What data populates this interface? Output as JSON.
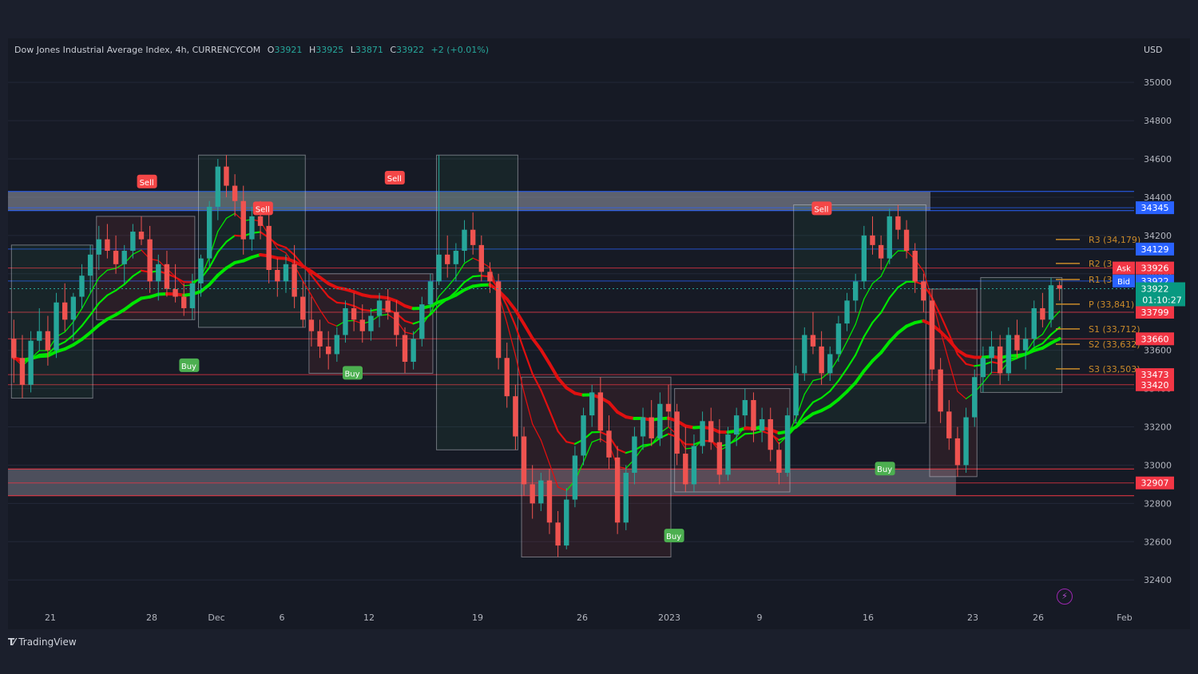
{
  "header": {
    "symbol": "Dow Jones Industrial Average Index, 4h, CURRENCYCOM",
    "o_label": "O",
    "o_value": "33921",
    "h_label": "H",
    "h_value": "33925",
    "l_label": "L",
    "l_value": "33871",
    "c_label": "C",
    "c_value": "33922",
    "change": "+2 (+0.01%)",
    "currency": "USD"
  },
  "branding": {
    "logo": "TradingView"
  },
  "colors": {
    "background": "#161a25",
    "up": "#26a69a",
    "down": "#ef5350",
    "ema_green": "#00e600",
    "ema_red": "#e01010",
    "pivot": "#c98a2a",
    "level_blue": "#2962ff",
    "level_red": "#f23645",
    "buy": "#4caf50",
    "sell": "#f44747"
  },
  "chart_data": {
    "type": "candlestick",
    "timeframe": "4h",
    "price_range": [
      32280,
      35130
    ],
    "x_ticks": [
      "21",
      "28",
      "Dec",
      "6",
      "12",
      "19",
      "26",
      "2023",
      "9",
      "16",
      "23",
      "26",
      "Feb"
    ],
    "y_ticks": [
      35000,
      34800,
      34600,
      34400,
      34200,
      34000,
      33800,
      33600,
      33400,
      33200,
      33000,
      32800,
      32600,
      32400
    ],
    "pivots": [
      {
        "label": "R3 (34,179)",
        "value": 34179
      },
      {
        "label": "R2 (3",
        "value": 34054
      },
      {
        "label": "R1 (3",
        "value": 33970
      },
      {
        "label": "P (33,841)",
        "value": 33841
      },
      {
        "label": "S1 (33,712)",
        "value": 33712
      },
      {
        "label": "S2 (33,632)",
        "value": 33632
      },
      {
        "label": "S3 (33,503)",
        "value": 33503
      }
    ],
    "price_tags": [
      {
        "text": "34345",
        "value": 34345,
        "color": "#2962ff"
      },
      {
        "text": "34129",
        "value": 34129,
        "color": "#2962ff"
      },
      {
        "text": "33926",
        "value": 34030,
        "color": "#f23645",
        "prefix": "Ask"
      },
      {
        "text": "33922",
        "value": 33962,
        "color": "#2962ff",
        "prefix": "Bid"
      },
      {
        "text": "33799",
        "value": 33799,
        "color": "#f23645"
      },
      {
        "text": "33660",
        "value": 33660,
        "color": "#f23645"
      },
      {
        "text": "33473",
        "value": 33473,
        "color": "#f23645"
      },
      {
        "text": "33420",
        "value": 33420,
        "color": "#f23645"
      },
      {
        "text": "32907",
        "value": 32907,
        "color": "#f23645"
      }
    ],
    "last_price": {
      "value": 33922,
      "countdown": "01:10:27"
    },
    "signals": [
      {
        "type": "Sell",
        "x": 0.13,
        "price": 34480
      },
      {
        "type": "Buy",
        "x": 0.17,
        "price": 33520
      },
      {
        "type": "Sell",
        "x": 0.24,
        "price": 34340
      },
      {
        "type": "Buy",
        "x": 0.325,
        "price": 33480
      },
      {
        "type": "Sell",
        "x": 0.365,
        "price": 34500
      },
      {
        "type": "Buy",
        "x": 0.63,
        "price": 32630
      },
      {
        "type": "Sell",
        "x": 0.77,
        "price": 34340
      },
      {
        "type": "Buy",
        "x": 0.83,
        "price": 32980
      }
    ],
    "zones": [
      {
        "from": 34330,
        "to": 34430,
        "color": "blue"
      },
      {
        "from": 32840,
        "to": 32980,
        "color": "red"
      }
    ],
    "candles": [
      [
        33660,
        33760,
        33430,
        33560
      ],
      [
        33560,
        33680,
        33350,
        33420
      ],
      [
        33420,
        33700,
        33380,
        33650
      ],
      [
        33650,
        33820,
        33600,
        33700
      ],
      [
        33700,
        33780,
        33520,
        33600
      ],
      [
        33600,
        33900,
        33560,
        33850
      ],
      [
        33850,
        33950,
        33700,
        33760
      ],
      [
        33760,
        33900,
        33650,
        33880
      ],
      [
        33880,
        34050,
        33820,
        33990
      ],
      [
        33990,
        34150,
        33900,
        34100
      ],
      [
        34100,
        34250,
        34020,
        34180
      ],
      [
        34180,
        34260,
        34080,
        34120
      ],
      [
        34120,
        34200,
        34000,
        34050
      ],
      [
        34050,
        34150,
        33950,
        34120
      ],
      [
        34120,
        34260,
        34080,
        34220
      ],
      [
        34220,
        34300,
        34150,
        34180
      ],
      [
        34180,
        34250,
        33900,
        33960
      ],
      [
        33960,
        34100,
        33860,
        34050
      ],
      [
        34050,
        34120,
        33880,
        33920
      ],
      [
        33920,
        34050,
        33850,
        33880
      ],
      [
        33880,
        33950,
        33780,
        33820
      ],
      [
        33820,
        34000,
        33760,
        33950
      ],
      [
        33950,
        34100,
        33880,
        34080
      ],
      [
        34080,
        34380,
        34040,
        34350
      ],
      [
        34350,
        34600,
        34280,
        34560
      ],
      [
        34560,
        34620,
        34400,
        34460
      ],
      [
        34460,
        34520,
        34300,
        34380
      ],
      [
        34380,
        34460,
        34100,
        34180
      ],
      [
        34180,
        34350,
        34120,
        34300
      ],
      [
        34300,
        34380,
        34180,
        34250
      ],
      [
        34250,
        34320,
        33950,
        34020
      ],
      [
        34020,
        34080,
        33880,
        33960
      ],
      [
        33960,
        34100,
        33900,
        34050
      ],
      [
        34050,
        34150,
        33820,
        33880
      ],
      [
        33880,
        33960,
        33720,
        33760
      ],
      [
        33760,
        33880,
        33620,
        33700
      ],
      [
        33700,
        33760,
        33560,
        33620
      ],
      [
        33620,
        33700,
        33500,
        33580
      ],
      [
        33580,
        33720,
        33540,
        33680
      ],
      [
        33680,
        33860,
        33640,
        33820
      ],
      [
        33820,
        33900,
        33700,
        33760
      ],
      [
        33760,
        33840,
        33640,
        33700
      ],
      [
        33700,
        33820,
        33650,
        33780
      ],
      [
        33780,
        33900,
        33720,
        33860
      ],
      [
        33860,
        33920,
        33760,
        33800
      ],
      [
        33800,
        33860,
        33620,
        33680
      ],
      [
        33680,
        33720,
        33480,
        33540
      ],
      [
        33540,
        33700,
        33500,
        33660
      ],
      [
        33660,
        33880,
        33620,
        33840
      ],
      [
        33840,
        34000,
        33800,
        33960
      ],
      [
        33960,
        34620,
        33940,
        34100
      ],
      [
        34100,
        34200,
        33980,
        34050
      ],
      [
        34050,
        34160,
        33960,
        34120
      ],
      [
        34120,
        34280,
        34060,
        34230
      ],
      [
        34230,
        34320,
        34100,
        34150
      ],
      [
        34150,
        34200,
        33960,
        34010
      ],
      [
        34010,
        34060,
        33900,
        33960
      ],
      [
        33960,
        34000,
        33500,
        33560
      ],
      [
        33560,
        33640,
        33300,
        33360
      ],
      [
        33360,
        33420,
        33080,
        33150
      ],
      [
        33150,
        33200,
        32840,
        32900
      ],
      [
        32900,
        33000,
        32720,
        32800
      ],
      [
        32800,
        32960,
        32760,
        32920
      ],
      [
        32920,
        32980,
        32640,
        32700
      ],
      [
        32700,
        32760,
        32520,
        32580
      ],
      [
        32580,
        32880,
        32560,
        32820
      ],
      [
        32820,
        33100,
        32780,
        33050
      ],
      [
        33050,
        33300,
        33000,
        33260
      ],
      [
        33260,
        33420,
        33200,
        33380
      ],
      [
        33380,
        33460,
        33120,
        33180
      ],
      [
        33180,
        33260,
        32980,
        33040
      ],
      [
        33040,
        33100,
        32640,
        32700
      ],
      [
        32700,
        33000,
        32660,
        32960
      ],
      [
        32960,
        33200,
        32900,
        33150
      ],
      [
        33150,
        33300,
        33080,
        33250
      ],
      [
        33250,
        33340,
        33100,
        33140
      ],
      [
        33140,
        33380,
        33100,
        33320
      ],
      [
        33320,
        33420,
        33200,
        33280
      ],
      [
        33280,
        33320,
        33000,
        33060
      ],
      [
        33060,
        33200,
        32860,
        32900
      ],
      [
        32900,
        33160,
        32860,
        33100
      ],
      [
        33100,
        33280,
        33060,
        33230
      ],
      [
        33230,
        33300,
        33080,
        33120
      ],
      [
        33120,
        33240,
        32900,
        32950
      ],
      [
        32950,
        33200,
        32920,
        33160
      ],
      [
        33160,
        33300,
        33100,
        33260
      ],
      [
        33260,
        33400,
        33200,
        33340
      ],
      [
        33340,
        33380,
        33120,
        33180
      ],
      [
        33180,
        33300,
        33120,
        33240
      ],
      [
        33240,
        33300,
        33020,
        33080
      ],
      [
        33080,
        33120,
        32900,
        32960
      ],
      [
        32960,
        33300,
        32940,
        33260
      ],
      [
        33260,
        33520,
        33220,
        33480
      ],
      [
        33480,
        33720,
        33440,
        33680
      ],
      [
        33680,
        33800,
        33580,
        33620
      ],
      [
        33620,
        33700,
        33420,
        33480
      ],
      [
        33480,
        33620,
        33440,
        33580
      ],
      [
        33580,
        33780,
        33540,
        33740
      ],
      [
        33740,
        33900,
        33700,
        33860
      ],
      [
        33860,
        34000,
        33800,
        33960
      ],
      [
        33960,
        34250,
        33920,
        34200
      ],
      [
        34200,
        34300,
        34100,
        34150
      ],
      [
        34150,
        34200,
        34020,
        34080
      ],
      [
        34080,
        34340,
        34050,
        34300
      ],
      [
        34300,
        34360,
        34180,
        34230
      ],
      [
        34230,
        34280,
        34080,
        34120
      ],
      [
        34120,
        34160,
        33900,
        33960
      ],
      [
        33960,
        34000,
        33800,
        33860
      ],
      [
        33860,
        33920,
        33440,
        33500
      ],
      [
        33500,
        33560,
        33220,
        33280
      ],
      [
        33280,
        33340,
        33080,
        33140
      ],
      [
        33140,
        33200,
        32940,
        33000
      ],
      [
        33000,
        33300,
        32960,
        33250
      ],
      [
        33250,
        33500,
        33200,
        33460
      ],
      [
        33460,
        33620,
        33380,
        33560
      ],
      [
        33560,
        33700,
        33480,
        33620
      ],
      [
        33620,
        33680,
        33420,
        33480
      ],
      [
        33480,
        33720,
        33440,
        33680
      ],
      [
        33680,
        33760,
        33560,
        33600
      ],
      [
        33600,
        33720,
        33500,
        33660
      ],
      [
        33660,
        33860,
        33620,
        33820
      ],
      [
        33820,
        33900,
        33720,
        33760
      ],
      [
        33760,
        33980,
        33720,
        33940
      ],
      [
        33940,
        33960,
        33860,
        33922
      ]
    ]
  }
}
